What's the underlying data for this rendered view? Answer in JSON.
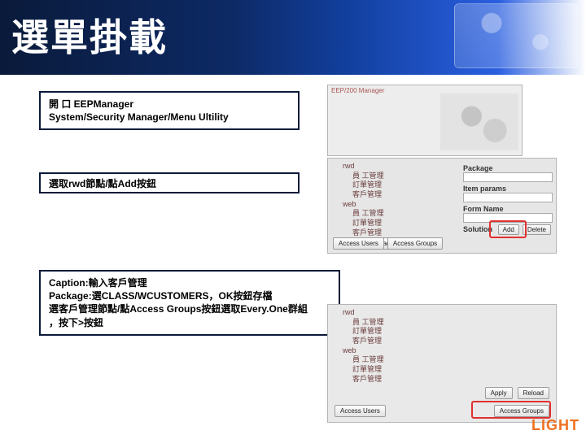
{
  "title": "選單掛載",
  "instructions": {
    "step1_line1": "開 口 EEPManager",
    "step1_line2": "System/Security Manager/Menu Ultility",
    "step2": "選取rwd節點/點Add按鈕",
    "step3_line1": "Caption:輸入客戶管理",
    "step3_line2": "Package:選CLASS/WCUSTOMERS，OK按鈕存檔",
    "step3_line3": "選客戶管理節點/點Access Groups按鈕選取Every.One群組",
    "step3_line4": "，按下>按鈕"
  },
  "mock": {
    "topHeader": "EEP/200 Manager",
    "tree": {
      "n1": "rwd",
      "n1a": "員 工管理",
      "n1b": "訂單管理",
      "n1c": "客戶管理",
      "n2": "web",
      "n2a": "員 工管理",
      "n2b": "訂單管理",
      "n2c": "客戶管理"
    },
    "labels": {
      "package": "Package",
      "itemParams": "Item params",
      "formName": "Form Name",
      "solution": "Solution"
    },
    "buttons": {
      "apply": "Apply",
      "reload": "Reload",
      "add": "Add",
      "delete": "Delete",
      "accessUsers": "Access Users",
      "accessGroups": "Access Groups"
    }
  },
  "logo": "LIGHT"
}
